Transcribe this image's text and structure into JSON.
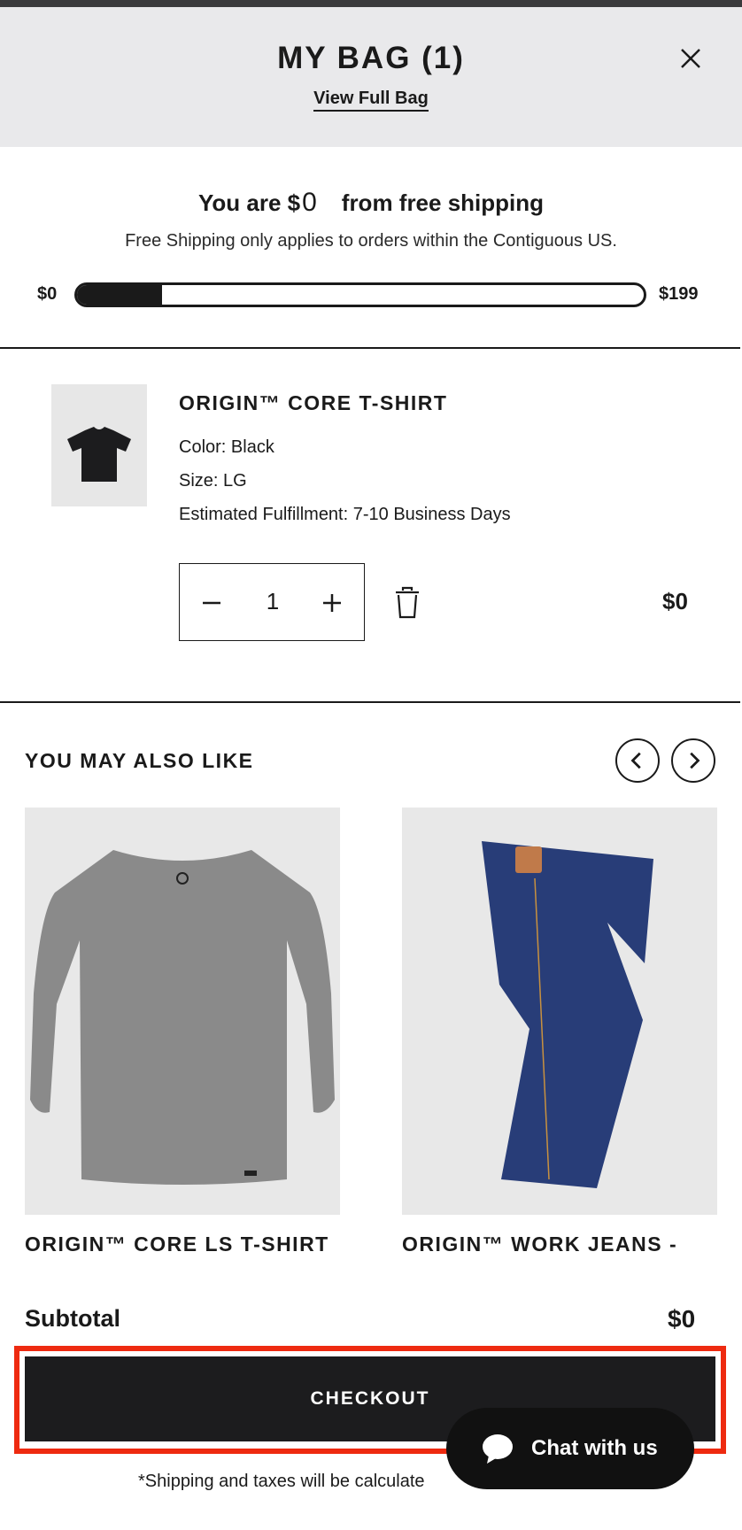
{
  "header": {
    "title": "MY BAG (1)",
    "view_full_bag": "View Full Bag"
  },
  "shipping": {
    "prefix": "You are $",
    "amount": "0",
    "suffix": "from free shipping",
    "note": "Free Shipping only applies to orders within the Contiguous US.",
    "bar_min": "$0",
    "bar_max": "$199",
    "progress_fraction": 0.15
  },
  "cart_item": {
    "name": "ORIGIN™ CORE T-SHIRT",
    "color": "Color: Black",
    "size": "Size: LG",
    "fulfillment": "Estimated Fulfillment: 7-10 Business Days",
    "quantity": "1",
    "price": "$0"
  },
  "recommendations": {
    "title": "YOU MAY ALSO LIKE",
    "items": [
      {
        "name": "ORIGIN™ CORE LS T-SHIRT"
      },
      {
        "name": "ORIGIN™ WORK JEANS -"
      }
    ]
  },
  "footer": {
    "subtotal_label": "Subtotal",
    "subtotal_value": "$0",
    "checkout_label": "CHECKOUT",
    "shipping_note": "*Shipping and taxes will be calculate",
    "chat_label": "Chat with us"
  },
  "colors": {
    "header_bg": "#e9e9eb",
    "checkout_bg": "#1c1c1e",
    "highlight": "#ee2a10"
  }
}
